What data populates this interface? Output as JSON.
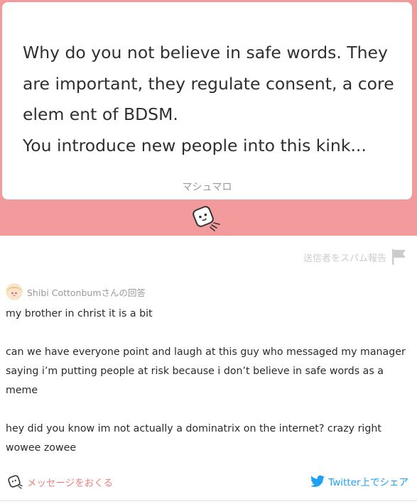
{
  "question": {
    "text": "Why do you not believe in safe words. They are important, they regulate consent, a core elem ent of BDSM.\nYou introduce new people into this kink...",
    "site_name": "マシュマロ"
  },
  "report": {
    "label": "送信者をスパム報告"
  },
  "answerer": {
    "label": "Shibi Cottonbumさんの回答"
  },
  "answer": {
    "paragraphs": [
      "my brother in christ it is a bit",
      "can we have everyone point and laugh at this guy who messaged my manager saying i’m putting people at risk because i don’t believe in safe words as a meme",
      "hey did you know im not actually a dominatrix on the internet? crazy right wowee zowee"
    ]
  },
  "footer": {
    "send_message_label": "メッセージをおくる",
    "share_label": "Twitter上でシェア"
  },
  "colors": {
    "accent_pink": "#f29a9c",
    "link_pink": "#ec7f80",
    "twitter_blue": "#1da1f2"
  },
  "icons": [
    "marshmallow-mascot-icon",
    "flag-icon",
    "avatar",
    "marshmallow-message-icon",
    "twitter-icon"
  ]
}
